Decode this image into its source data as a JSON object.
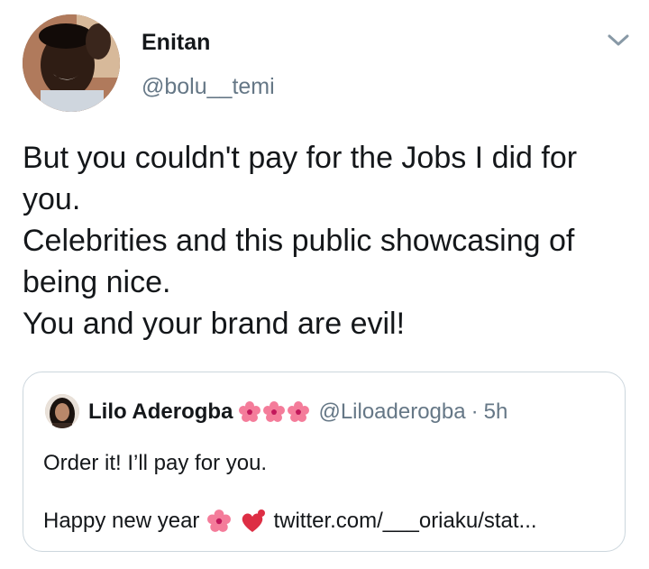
{
  "tweet": {
    "author": {
      "display_name": "Enitan",
      "handle": "@bolu__temi",
      "avatar_icon": "profile-photo"
    },
    "menu_icon": "chevron-down-icon",
    "body_lines": [
      "But you couldn't pay for the Jobs I did for",
      "you.",
      "Celebrities and this public showcasing of",
      "being nice.",
      "You and your brand are evil!"
    ]
  },
  "quoted_tweet": {
    "author": {
      "display_name": "Lilo Aderogba",
      "handle": "@Liloaderogba",
      "avatar_icon": "profile-photo"
    },
    "name_emojis": [
      "hibiscus",
      "hibiscus",
      "hibiscus"
    ],
    "separator": "·",
    "time": "5h",
    "text_line1": "Order it! I’ll pay for you.",
    "text_line2_prefix": "Happy new year",
    "text_line2_emojis": [
      "hibiscus",
      "heart-exclamation"
    ],
    "link_text": "twitter.com/___oriaku/stat..."
  },
  "colors": {
    "text": "#14171a",
    "secondary": "#657786",
    "border": "#ccd6dd",
    "hibiscus": "#f47c9a",
    "heart": "#dd2e44"
  }
}
